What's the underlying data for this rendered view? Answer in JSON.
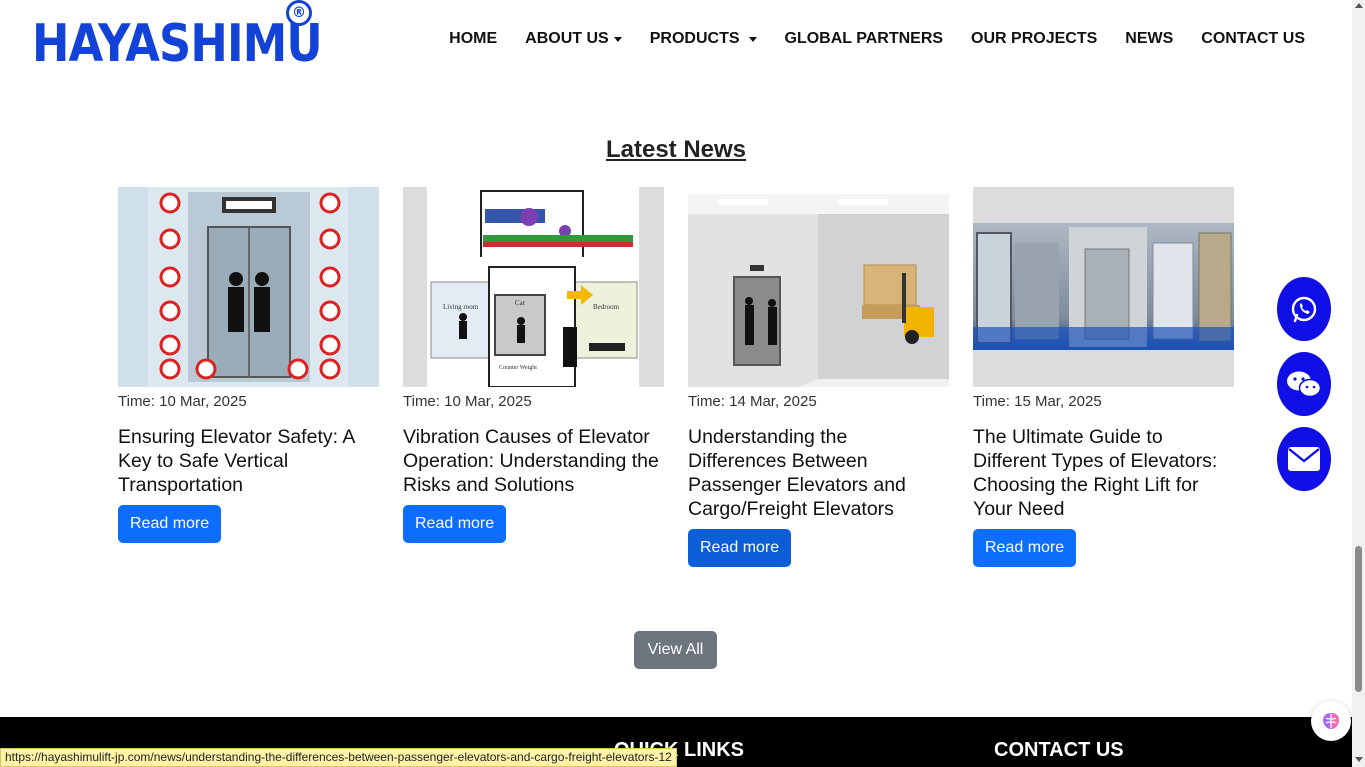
{
  "brand": {
    "name": "HAYASHIMU",
    "registered": "®"
  },
  "nav": [
    {
      "label": "HOME",
      "dropdown": false
    },
    {
      "label": "ABOUT US",
      "dropdown": true
    },
    {
      "label": "PRODUCTS",
      "dropdown": true
    },
    {
      "label": "GLOBAL PARTNERS",
      "dropdown": false
    },
    {
      "label": "OUR PROJECTS",
      "dropdown": false
    },
    {
      "label": "NEWS",
      "dropdown": false
    },
    {
      "label": "CONTACT US",
      "dropdown": false
    }
  ],
  "news": {
    "heading": "Latest News",
    "cards": [
      {
        "time": "Time: 10 Mar, 2025",
        "title": "Ensuring Elevator Safety: A Key to Safe Vertical Transportation",
        "button": "Read more"
      },
      {
        "time": "Time: 10 Mar, 2025",
        "title": "Vibration Causes of Elevator Operation: Understanding the Risks and Solutions",
        "button": "Read more"
      },
      {
        "time": "Time: 14 Mar, 2025",
        "title": "Understanding the Differences Between Passenger Elevators and Cargo/Freight Elevators",
        "button": "Read more"
      },
      {
        "time": "Time: 15 Mar, 2025",
        "title": "The Ultimate Guide to Different Types of Elevators: Choosing the Right Lift for Your Need",
        "button": "Read more"
      }
    ],
    "view_all": "View All"
  },
  "diagram_labels": {
    "living_room": "Living room",
    "car": "Car",
    "bedroom": "Bedroom",
    "counter_weight": "Counter Weight"
  },
  "floating": [
    "whatsapp-icon",
    "wechat-icon",
    "mail-icon"
  ],
  "footer": {
    "quick_links": "QUICK LINKS",
    "contact_us": "CONTACT US"
  },
  "status_url": "https://hayashimulift-jp.com/news/understanding-the-differences-between-passenger-elevators-and-cargo-freight-elevators-12",
  "colors": {
    "brand": "#1342d6",
    "primary": "#0d6efd",
    "float": "#0f0fe6",
    "secondary": "#6c757d"
  }
}
